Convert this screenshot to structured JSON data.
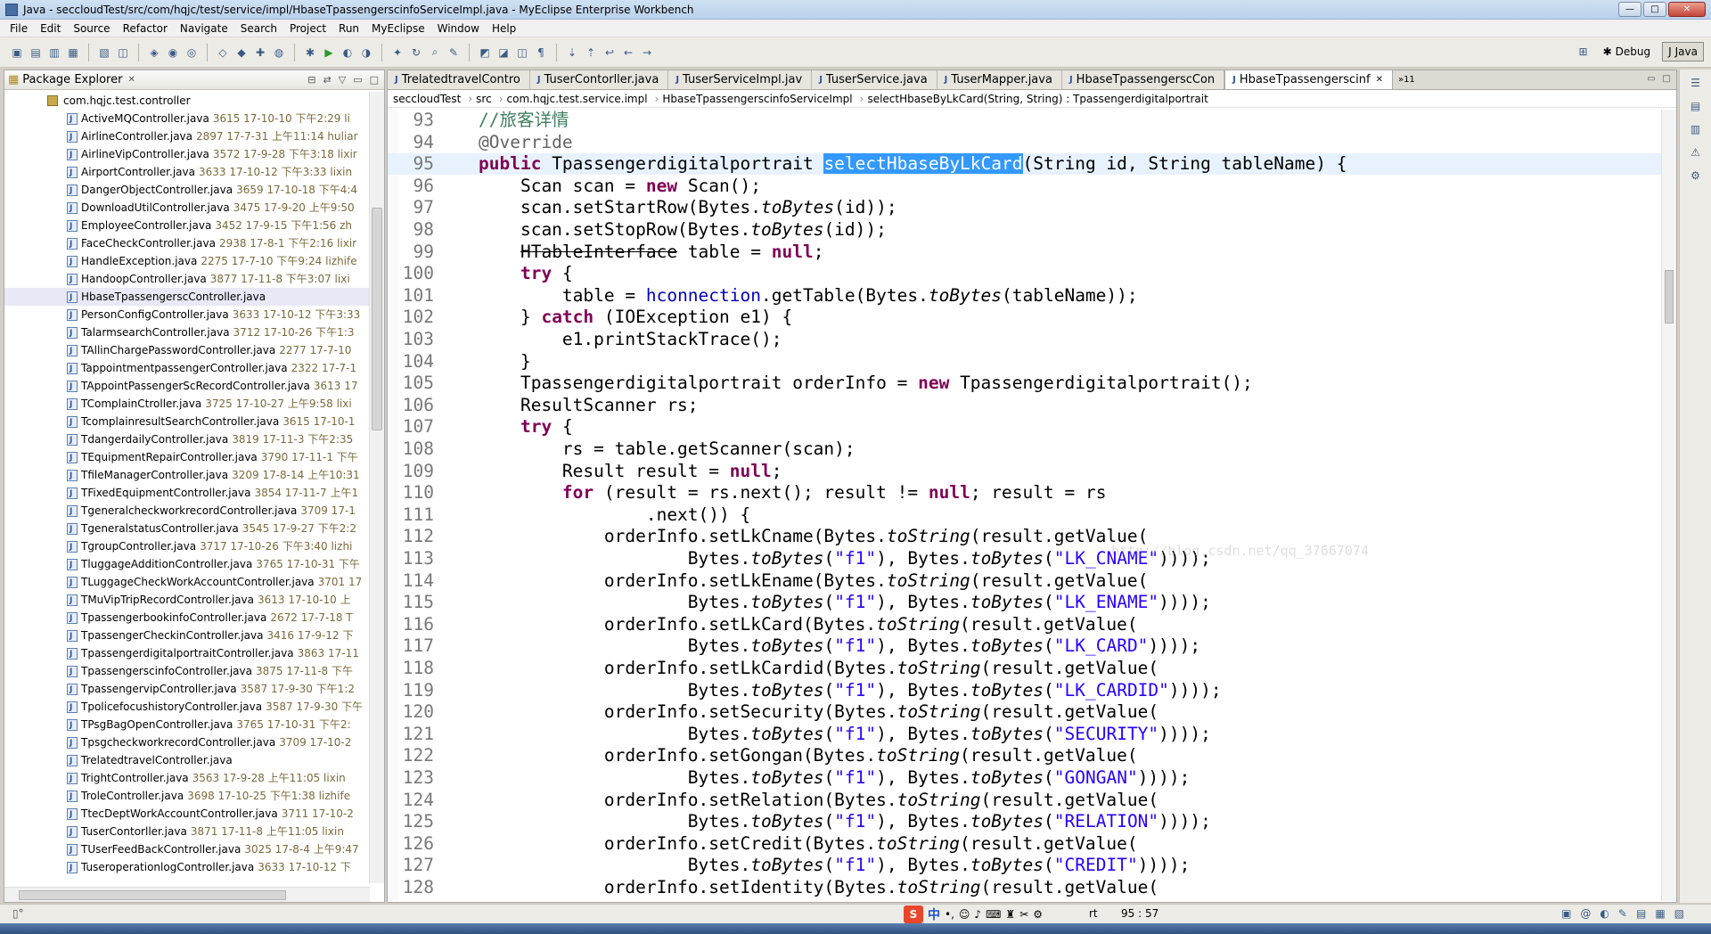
{
  "window": {
    "title": "Java - seccloudTest/src/com/hqjc/test/service/impl/HbaseTpassengerscinfoServiceImpl.java - MyEclipse Enterprise Workbench",
    "min": "—",
    "max": "□",
    "close": "✕"
  },
  "menu": [
    "File",
    "Edit",
    "Source",
    "Refactor",
    "Navigate",
    "Search",
    "Project",
    "Run",
    "MyEclipse",
    "Window",
    "Help"
  ],
  "perspectives": {
    "debug": "Debug",
    "java": "Java"
  },
  "explorer": {
    "title": "Package Explorer",
    "package": "com.hqjc.test.controller",
    "files": [
      {
        "name": "ActiveMQController.java",
        "meta": "3615  17-10-10 下午2:29  li"
      },
      {
        "name": "AirlineController.java",
        "meta": "2897  17-7-31 上午11:14  huliar"
      },
      {
        "name": "AirlineVipController.java",
        "meta": "3572  17-9-28 下午3:18  lixir"
      },
      {
        "name": "AirportController.java",
        "meta": "3633  17-10-12 下午3:33  lixin"
      },
      {
        "name": "DangerObjectController.java",
        "meta": "3659  17-10-18 下午4:4"
      },
      {
        "name": "DownloadUtilController.java",
        "meta": "3475  17-9-20 上午9:50"
      },
      {
        "name": "EmployeeController.java",
        "meta": "3452  17-9-15 下午1:56  zh"
      },
      {
        "name": "FaceCheckController.java",
        "meta": "2938  17-8-1 下午2:16  lixir"
      },
      {
        "name": "HandleException.java",
        "meta": "2275  17-7-10 下午9:24  lizhife"
      },
      {
        "name": "HandoopController.java",
        "meta": "3877  17-11-8 下午3:07  lixi"
      },
      {
        "name": "HbaseTpassengerscController.java",
        "meta": "",
        "selected": true
      },
      {
        "name": "PersonConfigController.java",
        "meta": "3633  17-10-12 下午3:33"
      },
      {
        "name": "TalarmsearchController.java",
        "meta": "3712  17-10-26 下午1:3"
      },
      {
        "name": "TAllinChargePasswordController.java",
        "meta": "2277  17-7-10"
      },
      {
        "name": "TappointmentpassengerController.java",
        "meta": "2322  17-7-1"
      },
      {
        "name": "TAppointPassengerScRecordController.java",
        "meta": "3613  17"
      },
      {
        "name": "TComplainCtroller.java",
        "meta": "3725  17-10-27 上午9:58  lixi"
      },
      {
        "name": "TcomplainresultSearchController.java",
        "meta": "3615  17-10-1"
      },
      {
        "name": "TdangerdailyController.java",
        "meta": "3819  17-11-3 下午2:35"
      },
      {
        "name": "TEquipmentRepairController.java",
        "meta": "3790  17-11-1 下午"
      },
      {
        "name": "TfileManagerController.java",
        "meta": "3209  17-8-14 上午10:31"
      },
      {
        "name": "TFixedEquipmentController.java",
        "meta": "3854  17-11-7 上午1"
      },
      {
        "name": "TgeneralcheckworkrecordController.java",
        "meta": "3709  17-1"
      },
      {
        "name": "TgeneralstatusController.java",
        "meta": "3545  17-9-27 下午2:2"
      },
      {
        "name": "TgroupController.java",
        "meta": "3717  17-10-26 下午3:40  lizhi"
      },
      {
        "name": "TluggageAdditionController.java",
        "meta": "3765  17-10-31 下午"
      },
      {
        "name": "TLuggageCheckWorkAccountController.java",
        "meta": "3701  17"
      },
      {
        "name": "TMuVipTripRecordController.java",
        "meta": "3613  17-10-10 上"
      },
      {
        "name": "TpassengerbookinfoController.java",
        "meta": "2672  17-7-18 T"
      },
      {
        "name": "TpassengerCheckinController.java",
        "meta": "3416  17-9-12 下"
      },
      {
        "name": "TpassengerdigitalportraitController.java",
        "meta": "3863  17-11"
      },
      {
        "name": "TpassengerscinfoController.java",
        "meta": "3875  17-11-8 下午"
      },
      {
        "name": "TpassengervipController.java",
        "meta": "3587  17-9-30 下午1:2"
      },
      {
        "name": "TpolicefocushistoryController.java",
        "meta": "3587  17-9-30 下午"
      },
      {
        "name": "TPsgBagOpenController.java",
        "meta": "3765  17-10-31 下午2:"
      },
      {
        "name": "TpsgcheckworkrecordController.java",
        "meta": "3709  17-10-2"
      },
      {
        "name": "TrelatedtravelController.java",
        "meta": ""
      },
      {
        "name": "TrightController.java",
        "meta": "3563  17-9-28 上午11:05  lixin"
      },
      {
        "name": "TroleController.java",
        "meta": "3698  17-10-25 下午1:38  lizhife"
      },
      {
        "name": "TtecDeptWorkAccountController.java",
        "meta": "3711  17-10-2"
      },
      {
        "name": "TuserContorller.java",
        "meta": "3871  17-11-8 上午11:05  lixin"
      },
      {
        "name": "TUserFeedBackController.java",
        "meta": "3025  17-8-4 上午9:47"
      },
      {
        "name": "TuseroperationlogController.java",
        "meta": "3633  17-10-12 下"
      }
    ]
  },
  "editor": {
    "tabs": [
      {
        "label": "TrelatedtravelContro"
      },
      {
        "label": "TuserContorller.java"
      },
      {
        "label": "TuserServiceImpl.jav"
      },
      {
        "label": "TuserService.java"
      },
      {
        "label": "TuserMapper.java"
      },
      {
        "label": "HbaseTpassengerscCon"
      },
      {
        "label": "HbaseTpassengerscinf",
        "active": true
      }
    ],
    "more_tabs": "»11",
    "breadcrumb": [
      "seccloudTest",
      "src",
      "com.hqjc.test.service.impl",
      "HbaseTpassengerscinfoServiceImpl",
      "selectHbaseByLkCard(String, String) : Tpassengerdigitalportrait"
    ],
    "watermark": "http://blog.csdn.net/qq_37667074",
    "line_numbers": [
      "93",
      "94",
      "95",
      "96",
      "97",
      "98",
      "99",
      "100",
      "101",
      "102",
      "103",
      "104",
      "105",
      "106",
      "107",
      "108",
      "109",
      "110",
      "111",
      "112",
      "113",
      "114",
      "115",
      "116",
      "117",
      "118",
      "119",
      "120",
      "121",
      "122",
      "123",
      "124",
      "125",
      "126",
      "127",
      "128"
    ]
  },
  "status": {
    "insert_mode": "rt",
    "cursor": "95 : 57",
    "ime_label": "中"
  }
}
